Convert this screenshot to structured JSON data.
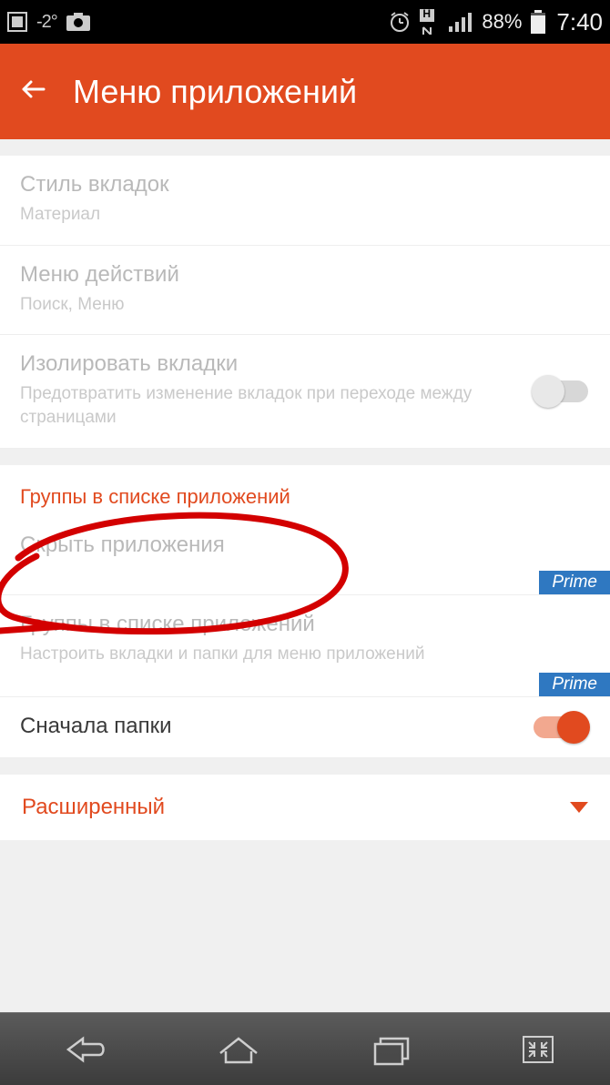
{
  "status": {
    "temperature": "-2°",
    "battery_pct": "88%",
    "time": "7:40",
    "network_badge": "H"
  },
  "appbar": {
    "title": "Меню приложений"
  },
  "rows": {
    "tab_style": {
      "title": "Стиль вкладок",
      "sub": "Материал"
    },
    "action_menu": {
      "title": "Меню действий",
      "sub": "Поиск, Меню"
    },
    "isolate_tabs": {
      "title": "Изолировать вкладки",
      "sub": "Предотвратить изменение вкладок при переходе между страницами"
    }
  },
  "group_section": {
    "header": "Группы в списке приложений",
    "hide_apps": {
      "title": "Скрыть приложения"
    },
    "drawer_groups": {
      "title": "Группы в списке приложений",
      "sub": "Настроить вкладки и папки для меню приложений"
    },
    "prime_badge": "Prime",
    "folders_first": {
      "title": "Сначала папки"
    }
  },
  "advanced": {
    "label": "Расширенный"
  }
}
